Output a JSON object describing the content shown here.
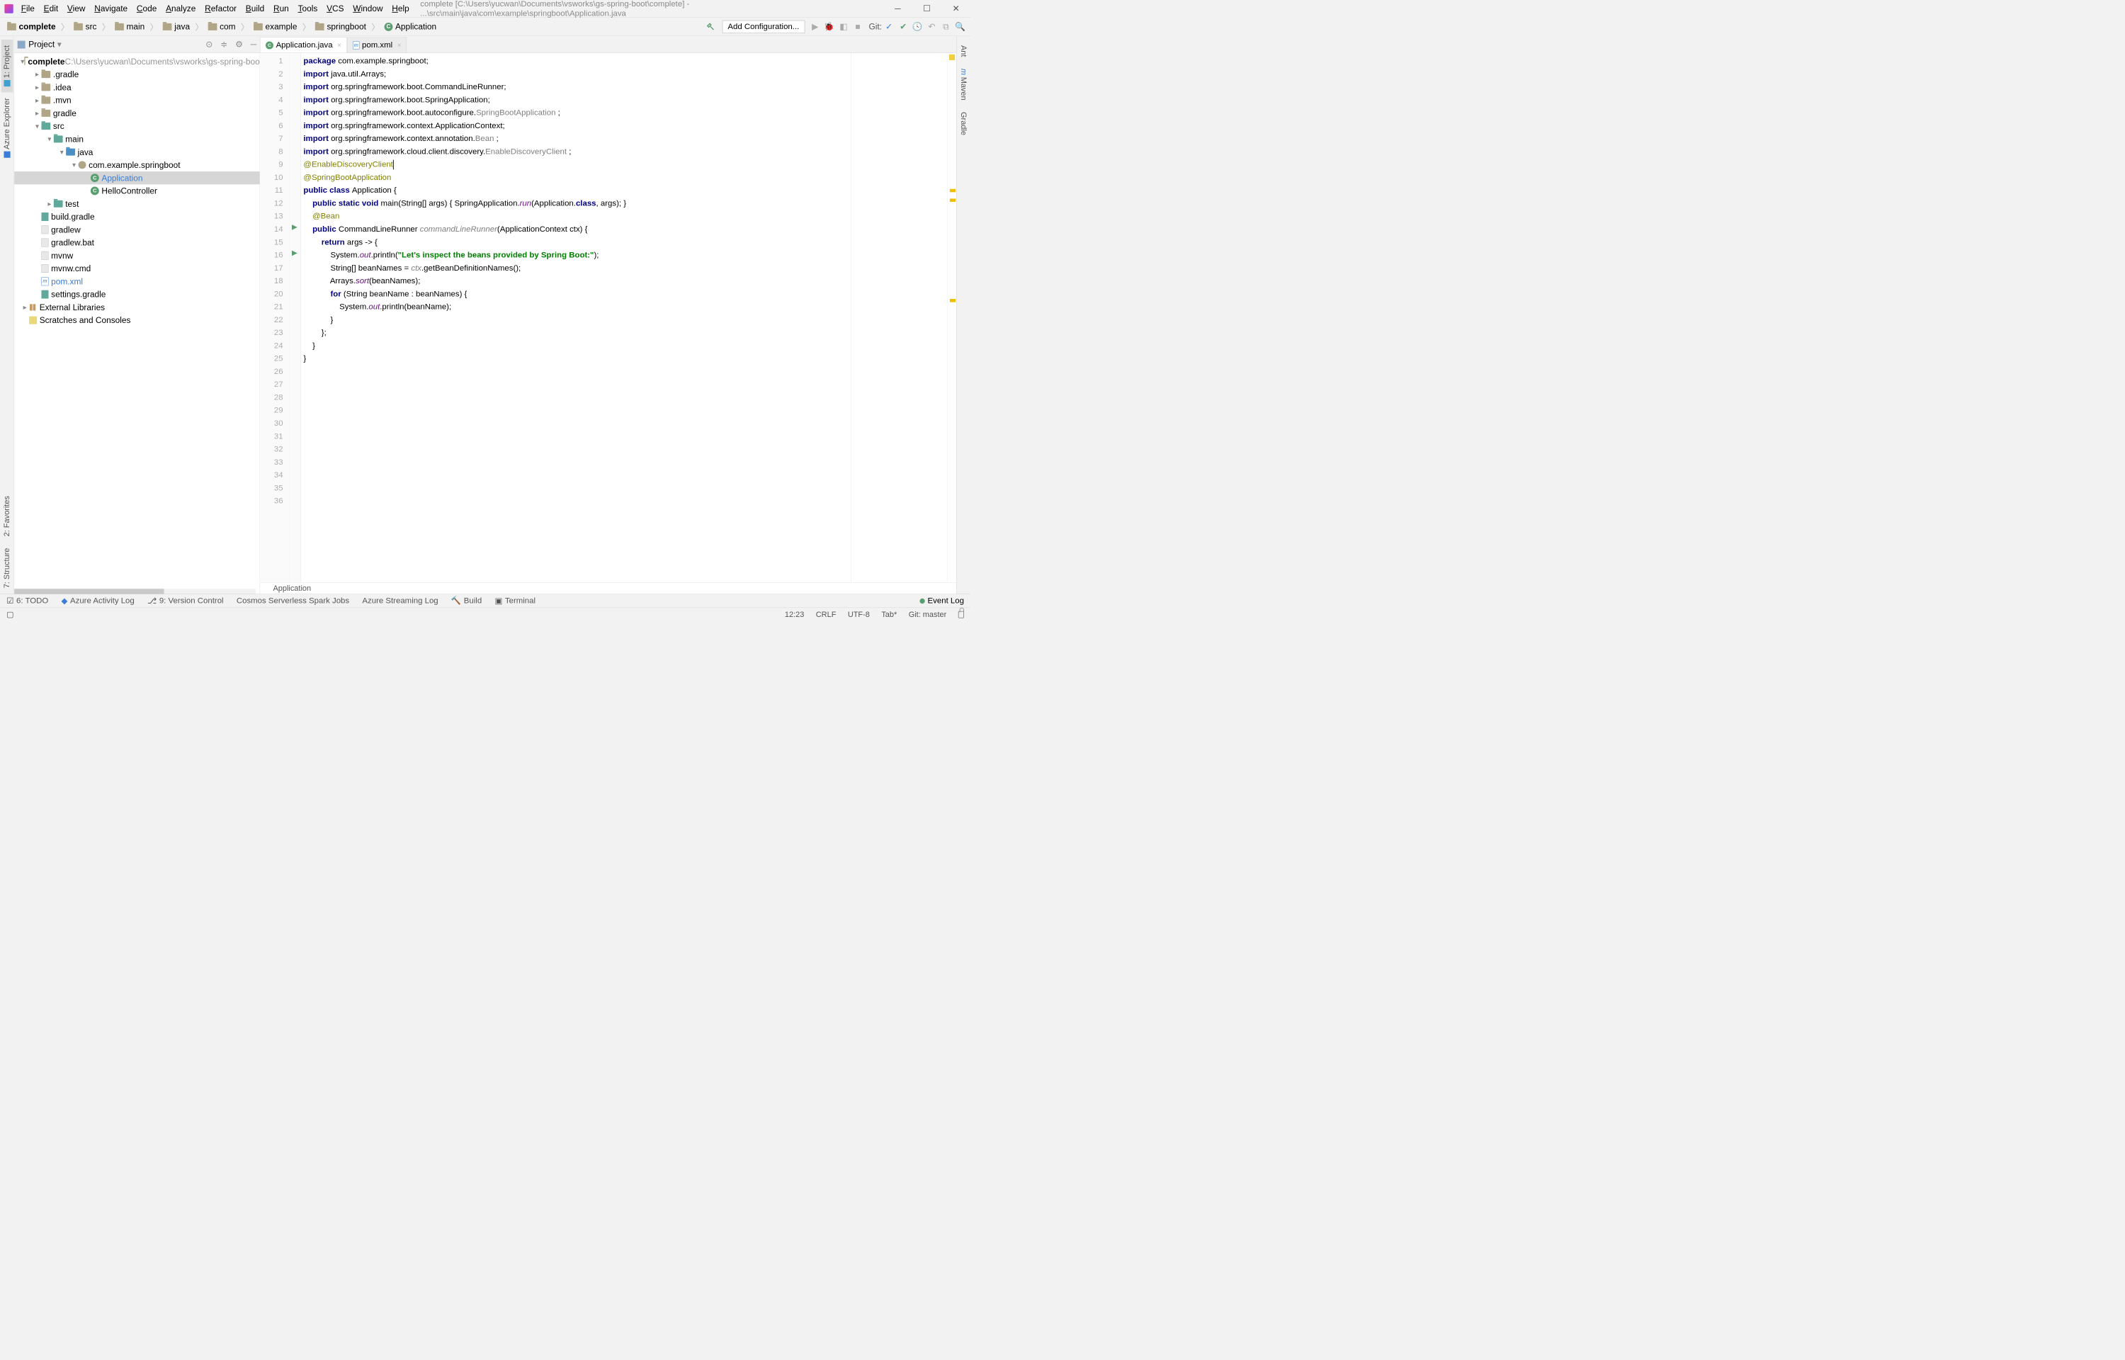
{
  "title": {
    "menus": [
      "File",
      "Edit",
      "View",
      "Navigate",
      "Code",
      "Analyze",
      "Refactor",
      "Build",
      "Run",
      "Tools",
      "VCS",
      "Window",
      "Help"
    ],
    "path": "complete [C:\\Users\\yucwan\\Documents\\vsworks\\gs-spring-boot\\complete] - ...\\src\\main\\java\\com\\example\\springboot\\Application.java"
  },
  "breadcrumbs": [
    "complete",
    "src",
    "main",
    "java",
    "com",
    "example",
    "springboot",
    "Application"
  ],
  "toolbar": {
    "addConfig": "Add Configuration...",
    "git": "Git:"
  },
  "leftTabs": {
    "project": "1: Project",
    "azure": "Azure Explorer"
  },
  "rightTabs": {
    "ant": "Ant",
    "maven": "Maven",
    "gradle": "Gradle"
  },
  "farLeft": {
    "fav": "2: Favorites",
    "struct": "7: Structure"
  },
  "projectPanel": {
    "title": "Project",
    "rootName": "complete",
    "rootPath": "C:\\Users\\yucwan\\Documents\\vsworks\\gs-spring-boo",
    "dirs": {
      "gradle1": ".gradle",
      "idea": ".idea",
      "mvn": ".mvn",
      "gradle2": "gradle",
      "src": "src",
      "main": "main",
      "java": "java",
      "pkg": "com.example.springboot",
      "app": "Application",
      "hello": "HelloController",
      "test": "test",
      "buildgradle": "build.gradle",
      "gradlew": "gradlew",
      "gradlewbat": "gradlew.bat",
      "mvnw": "mvnw",
      "mvnwcmd": "mvnw.cmd",
      "pom": "pom.xml",
      "settings": "settings.gradle",
      "ext": "External Libraries",
      "scratch": "Scratches and Consoles"
    }
  },
  "tabs": {
    "app": "Application.java",
    "pom": "pom.xml"
  },
  "code": {
    "lines": [
      {
        "n": 1,
        "t": [
          [
            "kw",
            "package "
          ],
          [
            "",
            "com.example.springboot;"
          ]
        ]
      },
      {
        "n": 2,
        "t": [
          [
            "",
            ""
          ]
        ]
      },
      {
        "n": 3,
        "t": [
          [
            "kw",
            "import "
          ],
          [
            "",
            "java.util.Arrays;"
          ]
        ]
      },
      {
        "n": 4,
        "t": [
          [
            "",
            ""
          ]
        ]
      },
      {
        "n": 5,
        "t": [
          [
            "kw",
            "import "
          ],
          [
            "",
            "org.springframework.boot.CommandLineRunner;"
          ]
        ]
      },
      {
        "n": 6,
        "t": [
          [
            "kw",
            "import "
          ],
          [
            "",
            "org.springframework.boot.SpringApplication;"
          ]
        ]
      },
      {
        "n": 7,
        "t": [
          [
            "kw",
            "import "
          ],
          [
            "",
            "org.springframework.boot.autoconfigure."
          ],
          [
            "unused",
            "SpringBootApplication"
          ],
          [
            "",
            " ;"
          ]
        ]
      },
      {
        "n": 8,
        "t": [
          [
            "kw",
            "import "
          ],
          [
            "",
            "org.springframework.context.ApplicationContext;"
          ]
        ]
      },
      {
        "n": 9,
        "t": [
          [
            "kw",
            "import "
          ],
          [
            "",
            "org.springframework.context.annotation."
          ],
          [
            "unused",
            "Bean"
          ],
          [
            "",
            " ;"
          ]
        ]
      },
      {
        "n": 10,
        "t": [
          [
            "kw",
            "import "
          ],
          [
            "",
            "org.springframework.cloud.client.discovery."
          ],
          [
            "unused",
            "EnableDiscoveryClient"
          ],
          [
            "",
            " ;"
          ]
        ]
      },
      {
        "n": 11,
        "t": [
          [
            "",
            ""
          ]
        ]
      },
      {
        "n": 12,
        "t": [
          [
            "ann",
            "@EnableDiscoveryClient"
          ]
        ],
        "hl": true,
        "caret": true
      },
      {
        "n": 13,
        "t": [
          [
            "ann",
            "@SpringBootApplication"
          ]
        ]
      },
      {
        "n": 14,
        "t": [
          [
            "kw",
            "public class "
          ],
          [
            "",
            "Application {"
          ]
        ],
        "run": true
      },
      {
        "n": 15,
        "t": [
          [
            "",
            ""
          ]
        ]
      },
      {
        "n": 16,
        "t": [
          [
            "",
            "    "
          ],
          [
            "kw",
            "public static void "
          ],
          [
            "",
            "main(String[] args) { SpringApplication."
          ],
          [
            "field",
            "run"
          ],
          [
            "",
            "(Application."
          ],
          [
            "kw",
            "class"
          ],
          [
            "",
            ", args); }"
          ]
        ],
        "run": true
      },
      {
        "n": 17,
        "t": [
          [
            "",
            ""
          ]
        ]
      },
      {
        "n": 18,
        "t": [
          [
            "",
            ""
          ]
        ]
      },
      {
        "n": 20,
        "t": [
          [
            "",
            "    "
          ],
          [
            "ann",
            "@Bean"
          ]
        ]
      },
      {
        "n": 21,
        "t": [
          [
            "",
            "    "
          ],
          [
            "kw",
            "public "
          ],
          [
            "",
            "CommandLineRunner "
          ],
          [
            "used",
            "commandLineRunner"
          ],
          [
            "",
            "(ApplicationContext ctx) {"
          ]
        ]
      },
      {
        "n": 22,
        "t": [
          [
            "",
            "        "
          ],
          [
            "kw",
            "return "
          ],
          [
            "",
            "args -> {"
          ]
        ]
      },
      {
        "n": 23,
        "t": [
          [
            "",
            ""
          ]
        ]
      },
      {
        "n": 24,
        "t": [
          [
            "",
            "            System."
          ],
          [
            "field",
            "out"
          ],
          [
            "",
            ".println("
          ],
          [
            "str",
            "\"Let's inspect the beans provided by Spring Boot:\""
          ],
          [
            "",
            ");"
          ]
        ]
      },
      {
        "n": 25,
        "t": [
          [
            "",
            ""
          ]
        ]
      },
      {
        "n": 26,
        "t": [
          [
            "",
            "            String[] beanNames = "
          ],
          [
            "used",
            "ctx"
          ],
          [
            "",
            ".getBeanDefinitionNames();"
          ]
        ]
      },
      {
        "n": 27,
        "t": [
          [
            "",
            "            Arrays."
          ],
          [
            "field",
            "sort"
          ],
          [
            "",
            "(beanNames);"
          ]
        ]
      },
      {
        "n": 28,
        "t": [
          [
            "",
            "            "
          ],
          [
            "kw",
            "for "
          ],
          [
            "",
            "(String beanName : beanNames) {"
          ]
        ]
      },
      {
        "n": 29,
        "t": [
          [
            "",
            "                System."
          ],
          [
            "field",
            "out"
          ],
          [
            "",
            ".println(beanName);"
          ]
        ]
      },
      {
        "n": 30,
        "t": [
          [
            "",
            "            }"
          ]
        ]
      },
      {
        "n": 31,
        "t": [
          [
            "",
            ""
          ]
        ]
      },
      {
        "n": 32,
        "t": [
          [
            "",
            "        };"
          ]
        ]
      },
      {
        "n": 33,
        "t": [
          [
            "",
            "    }"
          ]
        ]
      },
      {
        "n": 34,
        "t": [
          [
            "",
            ""
          ]
        ]
      },
      {
        "n": 35,
        "t": [
          [
            "",
            "}"
          ]
        ]
      },
      {
        "n": 36,
        "t": [
          [
            "",
            ""
          ]
        ]
      }
    ],
    "breadcrumb": "Application"
  },
  "bottomTools": {
    "todo": "6: TODO",
    "azure": "Azure Activity Log",
    "vcs": "9: Version Control",
    "cosmos": "Cosmos Serverless Spark Jobs",
    "stream": "Azure Streaming Log",
    "build": "Build",
    "terminal": "Terminal",
    "event": "Event Log"
  },
  "status": {
    "pos": "12:23",
    "crlf": "CRLF",
    "enc": "UTF-8",
    "tab": "Tab*",
    "git": "Git: master"
  }
}
